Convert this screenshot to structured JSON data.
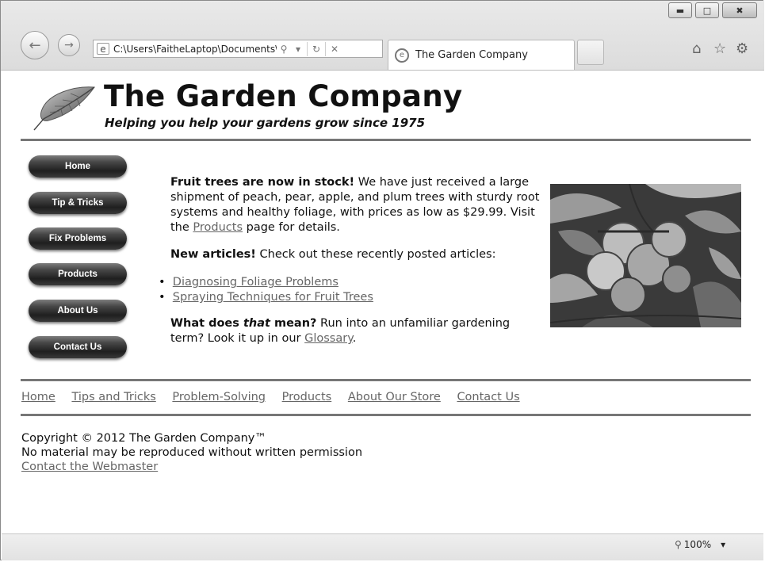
{
  "browser": {
    "address": "C:\\Users\\FaitheLaptop\\Documents\\M",
    "tab_title": "The Garden Company",
    "zoom": "100%"
  },
  "header": {
    "title": "The Garden Company",
    "tagline": "Helping you help your gardens grow since 1975"
  },
  "nav_buttons": [
    "Home",
    "Tip & Tricks",
    "Fix Problems",
    "Products",
    "About Us",
    "Contact Us"
  ],
  "main": {
    "p1_bold": "Fruit trees are now in stock!",
    "p1_text": " We have just received a large shipment of peach, pear, apple, and plum trees with sturdy root systems and healthy foliage, with prices as low as $29.99. Visit the ",
    "p1_link": "Products",
    "p1_end": " page for details.",
    "p2_bold": "New articles!",
    "p2_text": " Check out these recently posted articles:",
    "articles": [
      "Diagnosing Foliage Problems",
      "Spraying Techniques for Fruit Trees"
    ],
    "p3_bold_a": "What does ",
    "p3_em": "that",
    "p3_bold_b": " mean?",
    "p3_text": " Run into an unfamiliar gardening term? Look it up in our ",
    "p3_link": "Glossary",
    "p3_end": "."
  },
  "footer_nav": [
    "Home",
    "Tips and Tricks",
    "Problem-Solving",
    "Products",
    "About Our Store",
    "Contact Us"
  ],
  "copyright": {
    "line1": "Copyright © 2012 The Garden Company™",
    "line2": "No material may be reproduced without written permission",
    "webmaster": "Contact the Webmaster"
  }
}
